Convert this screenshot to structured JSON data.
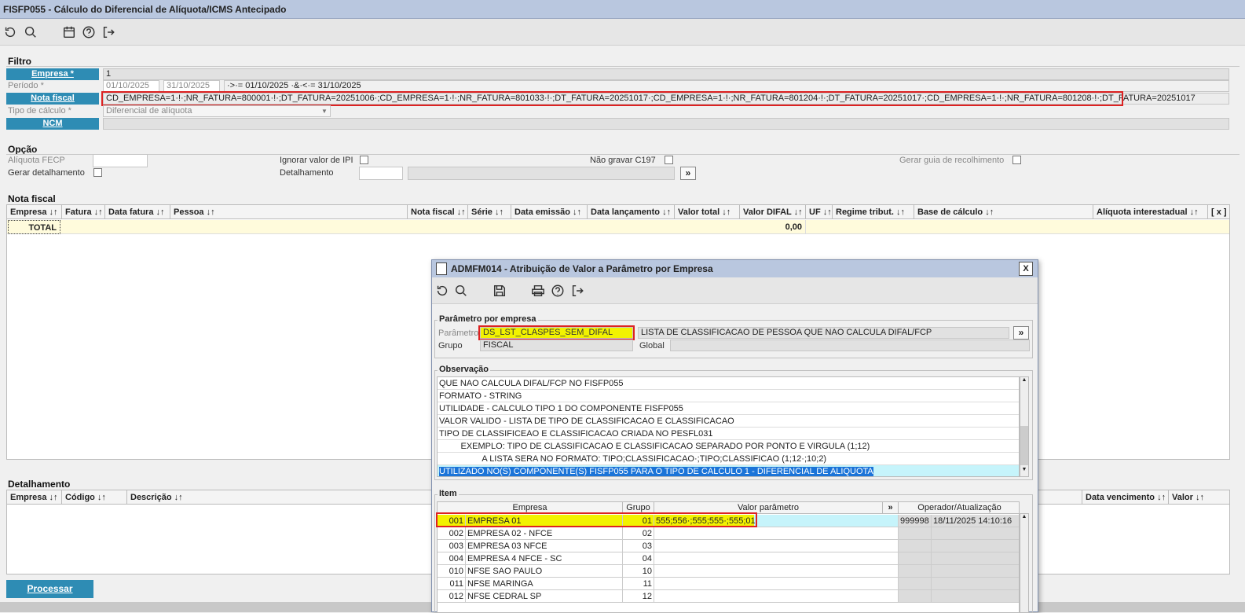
{
  "window": {
    "title": "FISFP055 - Cálculo do Diferencial de Alíquota/ICMS Antecipado"
  },
  "toolbar": {
    "icons": [
      "refresh-icon",
      "search-icon",
      "calendar-icon",
      "help-icon",
      "exit-icon"
    ]
  },
  "filtro": {
    "title": "Filtro",
    "empresa_label": "Empresa *",
    "empresa_value": "1",
    "periodo_label": "Período *",
    "periodo_start": "01/10/2025",
    "periodo_end": "31/10/2025",
    "periodo_expr": "·>·= 01/10/2025 ·&·<·= 31/10/2025",
    "nota_label": "Nota fiscal",
    "nota_value": "CD_EMPRESA=1·!·;NR_FATURA=800001·!·;DT_FATURA=20251006·;CD_EMPRESA=1·!·;NR_FATURA=801033·!·;DT_FATURA=20251017·;CD_EMPRESA=1·!·;NR_FATURA=801204·!·;DT_FATURA=20251017·;CD_EMPRESA=1·!·;NR_FATURA=801208·!·;DT_FATURA=20251017",
    "tipo_label": "Tipo de cálculo *",
    "tipo_value": "Diferencial de alíquota",
    "ncm_label": "NCM"
  },
  "opcao": {
    "title": "Opção",
    "aliquota_label": "Alíquota FECP",
    "gerar_det_label": "Gerar detalhamento",
    "ignorar_ipi_label": "Ignorar valor de IPI",
    "detalhamento_label": "Detalhamento",
    "nao_gravar_label": "Não gravar C197",
    "gerar_guia_label": "Gerar guia de recolhimento",
    "more_label": "»"
  },
  "nota_grid": {
    "title": "Nota fiscal",
    "columns": [
      "Empresa ↓↑",
      "Fatura ↓↑",
      "Data fatura ↓↑",
      "Pessoa ↓↑",
      "Nota fiscal ↓↑",
      "Série ↓↑",
      "Data emissão ↓↑",
      "Data lançamento ↓↑",
      "Valor total ↓↑",
      "Valor DIFAL ↓↑",
      "UF ↓↑",
      "Regime tribut. ↓↑",
      "Base de cálculo ↓↑",
      "Alíquota interestadual ↓↑",
      "[ x ]"
    ],
    "total_label": "TOTAL",
    "total_difal": "0,00"
  },
  "det_grid": {
    "title": "Detalhamento",
    "columns": [
      "Empresa ↓↑",
      "Código ↓↑",
      "Descrição ↓↑",
      "Data vencimento ↓↑",
      "Valor ↓↑"
    ]
  },
  "processar_label": "Processar",
  "dialog": {
    "title": "ADMFM014 - Atribuição de Valor a Parâmetro por Empresa",
    "close": "X",
    "param_group": "Parâmetro por empresa",
    "param_label": "Parâmetro",
    "param_value": "DS_LST_CLASPES_SEM_DIFAL",
    "param_desc": "LISTA DE CLASSIFICACAO DE PESSOA QUE NAO CALCULA DIFAL/FCP",
    "grupo_label": "Grupo",
    "grupo_value": "FISCAL",
    "global_label": "Global",
    "more": "»",
    "obs_group": "Observação",
    "obs_lines": [
      "QUE NAO CALCULA DIFAL/FCP NO FISFP055",
      "FORMATO - STRING",
      "UTILIDADE - CALCULO TIPO 1 DO COMPONENTE FISFP055",
      "VALOR VALIDO - LISTA DE TIPO DE CLASSIFICACAO E CLASSIFICACAO",
      "TIPO DE CLASSIFICEAO E CLASSIFICACAO CRIADA NO PESFL031",
      "         EXEMPLO: TIPO DE CLASSIFICACAO E CLASSIFICACAO SEPARADO POR PONTO E VIRGULA (1;12)",
      "                  A LISTA SERA NO FORMATO: TIPO;CLASSIFICACAO·;TIPO;CLASSIFICAO (1;12·;10;2)",
      "UTILIZADO NO(S) COMPONENTE(S) FISFP055  PARA O TIPO DE CALCULO 1 - DIFERENCIAL DE ALIQUOTA"
    ],
    "item_group": "Item",
    "item_cols": [
      "Empresa",
      "Grupo",
      "Valor parâmetro",
      "»",
      "Operador/Atualização"
    ],
    "items": [
      {
        "cod": "001",
        "nome": "EMPRESA 01",
        "grupo": "01",
        "valor": "555;556·;555;555·;555;01",
        "op": "999998",
        "dt": "18/11/2025 14:10:16"
      },
      {
        "cod": "002",
        "nome": "EMPRESA 02 - NFCE",
        "grupo": "02",
        "valor": "",
        "op": "",
        "dt": ""
      },
      {
        "cod": "003",
        "nome": "EMPRESA 03 NFCE",
        "grupo": "03",
        "valor": "",
        "op": "",
        "dt": ""
      },
      {
        "cod": "004",
        "nome": "EMPRESA 4 NFCE - SC",
        "grupo": "04",
        "valor": "",
        "op": "",
        "dt": ""
      },
      {
        "cod": "010",
        "nome": "NFSE SAO PAULO",
        "grupo": "10",
        "valor": "",
        "op": "",
        "dt": ""
      },
      {
        "cod": "011",
        "nome": "NFSE MARINGA",
        "grupo": "11",
        "valor": "",
        "op": "",
        "dt": ""
      },
      {
        "cod": "012",
        "nome": "NFSE CEDRAL SP",
        "grupo": "12",
        "valor": "",
        "op": "",
        "dt": ""
      }
    ]
  },
  "colors": {
    "accent": "#2e8cb4",
    "highlight": "#f2f200",
    "selected": "#1b74d8",
    "alert": "#dd2222"
  }
}
